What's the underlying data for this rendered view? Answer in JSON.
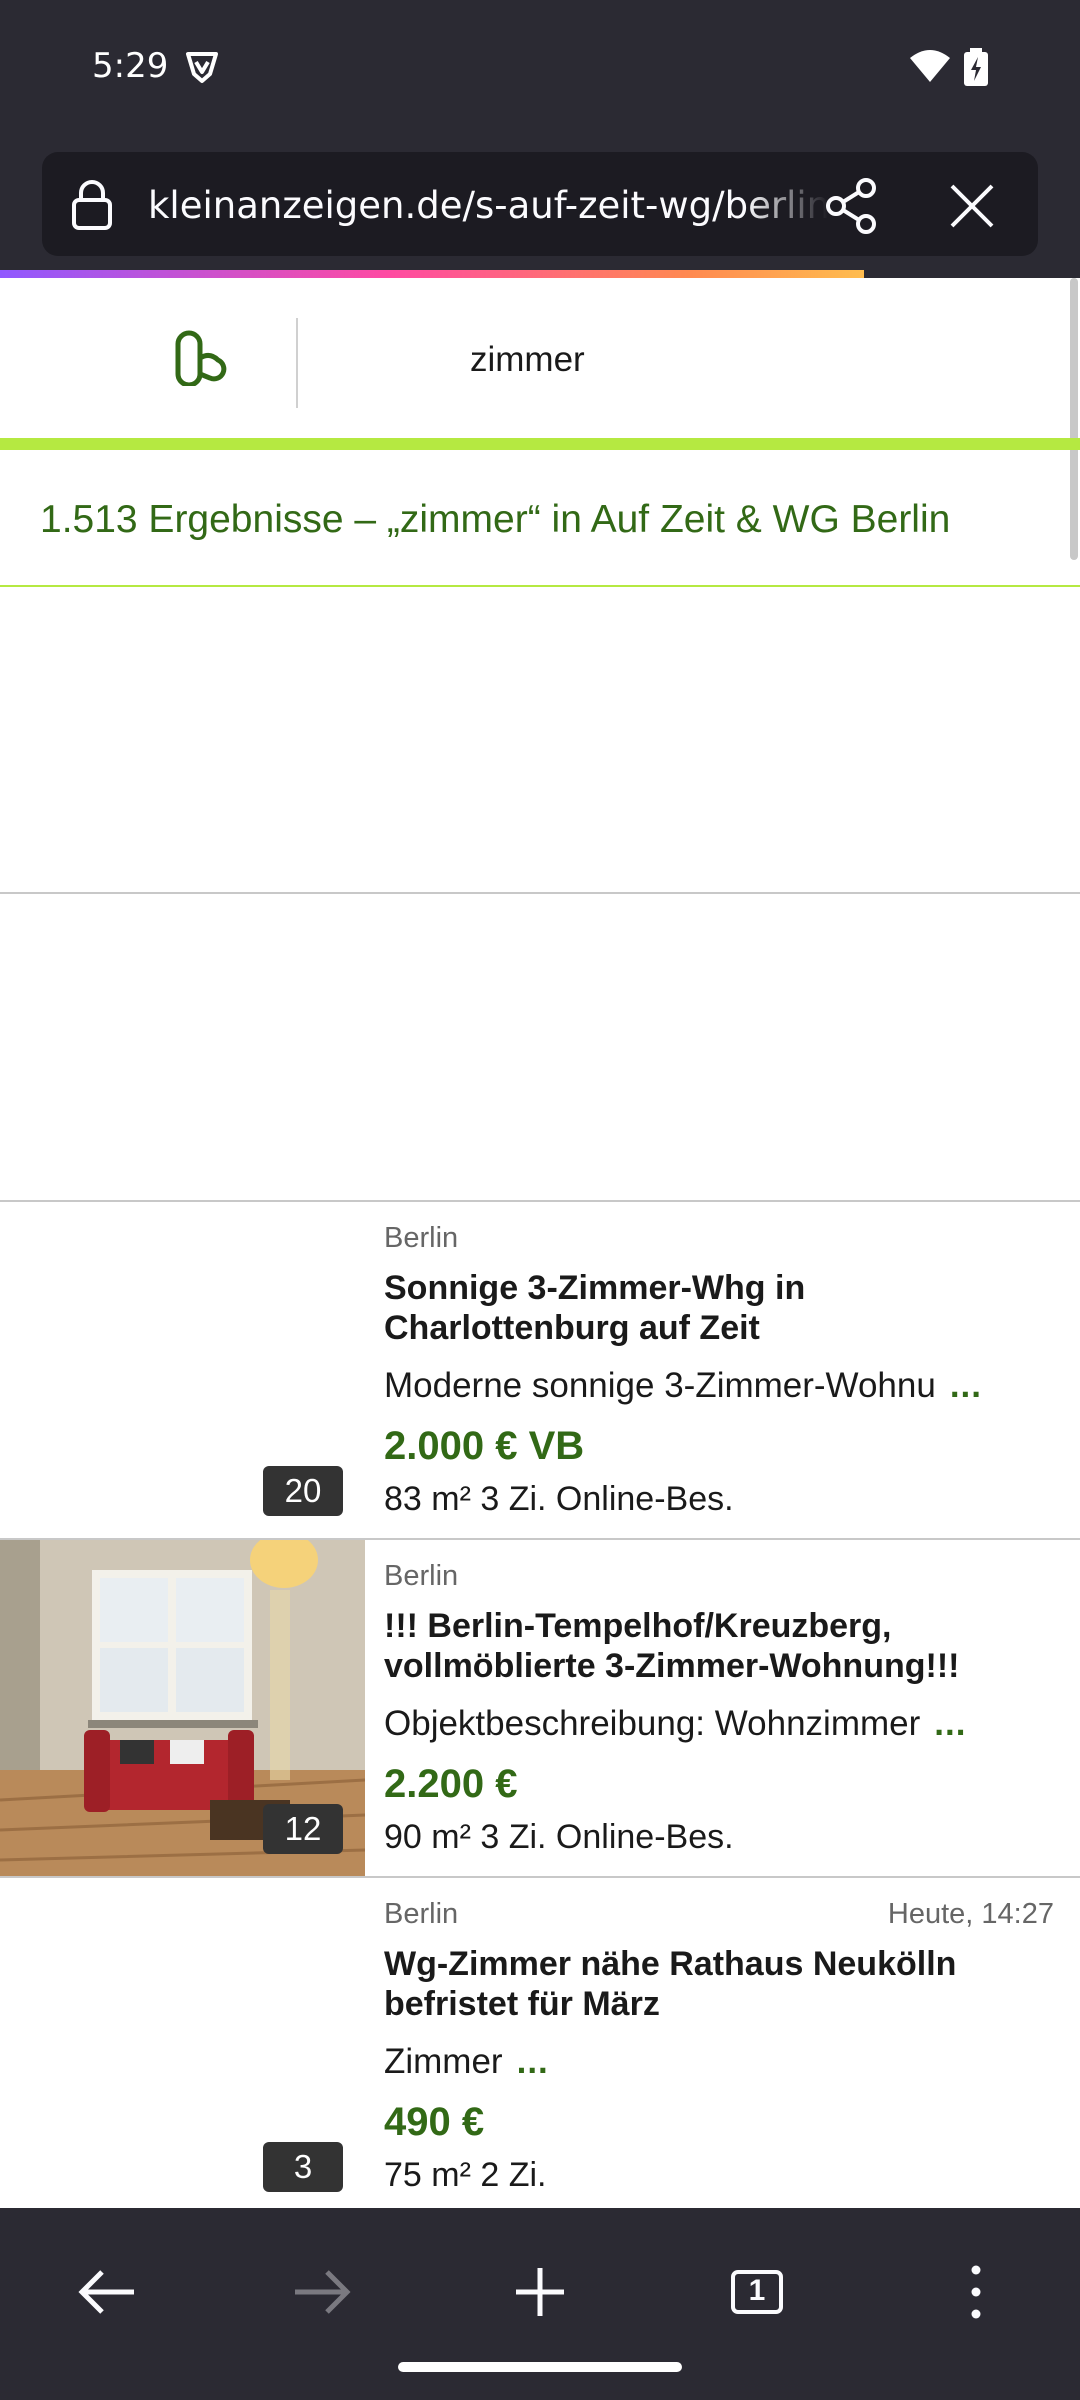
{
  "status_bar": {
    "time": "5:29",
    "vpn_icon": "vpn-shield-icon",
    "wifi_icon": "wifi-icon",
    "battery_icon": "battery-charging-icon"
  },
  "browser": {
    "url": "kleinanzeigen.de/s-auf-zeit-wg/berlin",
    "progress_percent": 80,
    "lock_icon": "lock-icon",
    "share_icon": "share-icon",
    "close_icon": "close-icon"
  },
  "site": {
    "logo_icon": "kleinanzeigen-logo-icon",
    "search_term": "zimmer",
    "accent_color": "#b5e941",
    "price_color": "#326916"
  },
  "results": {
    "heading": "1.513 Ergebnisse – „zimmer“ in Auf Zeit & WG Berlin"
  },
  "listings": [
    {
      "location": "Berlin",
      "date": "",
      "title": "Sonnige 3-Zimmer-Whg in Charlottenburg auf Zeit",
      "description": "Moderne sonnige 3-Zimmer-Wohnu",
      "more": "...",
      "price": "2.000 € VB",
      "specs": "83 m² 3 Zi. Online-Bes.",
      "image_count": "20",
      "has_image": false
    },
    {
      "location": "Berlin",
      "date": "",
      "title": "!!! Berlin-Tempelhof/Kreuzberg, vollmöblierte 3-Zimmer-Wohnung!!!",
      "description": "Objektbeschreibung: Wohnzimmer",
      "more": "...",
      "price": "2.200 €",
      "specs": "90 m² 3 Zi. Online-Bes.",
      "image_count": "12",
      "has_image": true
    },
    {
      "location": "Berlin",
      "date": "Heute, 14:27",
      "title": "Wg-Zimmer nähe Rathaus Neukölln befristet für März",
      "description": "Zimmer",
      "more": "...",
      "price": "490 €",
      "specs": "75 m² 2 Zi.",
      "image_count": "3",
      "has_image": false
    }
  ],
  "bottom_nav": {
    "back_icon": "back-arrow-icon",
    "forward_icon": "forward-arrow-icon",
    "new_tab_icon": "plus-icon",
    "tab_count": "1",
    "menu_icon": "more-vertical-icon"
  }
}
